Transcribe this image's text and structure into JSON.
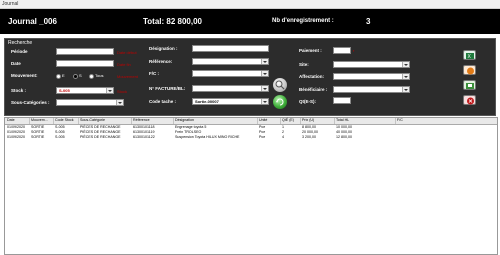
{
  "window": {
    "title": "Journal"
  },
  "header": {
    "journal": "Journal _006",
    "total": "Total: 82 800,00",
    "nb_label": "Nb d'enregistrement :",
    "nb_value": "3"
  },
  "search": {
    "legend": "Recherche",
    "left": {
      "periode_label": "Période",
      "periode_hint": "Date début",
      "date_label": "Date",
      "date_hint": "Date fin",
      "mouvement_label": "Mouvement:",
      "mouvement_options": [
        "E",
        "S",
        "Tous"
      ],
      "mouvement_selected": "S",
      "mouvement_hint": "Mouvement",
      "stock_label": "Stock :",
      "stock_value": "S-005",
      "stock_hint": "Stock",
      "sous_cat_label": "Sous-Catégories :",
      "sous_cat_value": ""
    },
    "middle": {
      "designation_label": "Désignation :",
      "designation_value": "",
      "reference_label": "Référence:",
      "reference_value": "",
      "fc_label": "F/C :",
      "fc_value": "",
      "facture_label": "N° FACTURE/BL:",
      "facture_value": "",
      "code_tache_label": "Code tache :",
      "code_tache_value": "Sortie-00007"
    },
    "right": {
      "paiement_label": "Paiement :",
      "paiement_value": "",
      "site_label": "Site:",
      "site_value": "",
      "affectation_label": "Affectation:",
      "affectation_value": "",
      "beneficiaire_label": "Bénéficiaire :",
      "beneficiaire_value": "",
      "qte_label": "Qt(E-S):",
      "qte_value": ""
    }
  },
  "grid": {
    "columns": [
      "Date",
      "Mouvem...",
      "Code Stock",
      "Sous-Catégorie",
      "Référence",
      "Désignation",
      "Unité",
      "QtÉ (E)",
      "Prix (U)",
      "Total HL",
      "F/C"
    ],
    "rows": [
      [
        "01/09/2020",
        "SORTIE",
        "S-005",
        "PIÈCES DE RECHANGE",
        "61300101118",
        "Engrenage toyota 5",
        "Pce",
        "1",
        "8 800,00",
        "10 000,00",
        ""
      ],
      [
        "01/09/2020",
        "SORTIE",
        "S-005",
        "PIÈCES DE RECHANGE",
        "61300101119",
        "Frein TROLSEO",
        "Pce",
        "2",
        "20 000,00",
        "40 000,00",
        ""
      ],
      [
        "01/09/2020",
        "SORTIE",
        "S-005",
        "PIÈCES DE RECHANGE",
        "61300101122",
        "Suspension Toyota HILUX MINO RICHE",
        "Pce",
        "4",
        "3 200,00",
        "12 800,00",
        ""
      ]
    ]
  },
  "colors": {
    "header_bg": "#000000",
    "panel_bg": "#2c2c2c",
    "hint": "#c00000",
    "selected_row": "#3a6ea5"
  },
  "icons": [
    "excel-icon",
    "pdf-icon",
    "print-icon",
    "close-icon",
    "search-icon",
    "refresh-icon"
  ]
}
